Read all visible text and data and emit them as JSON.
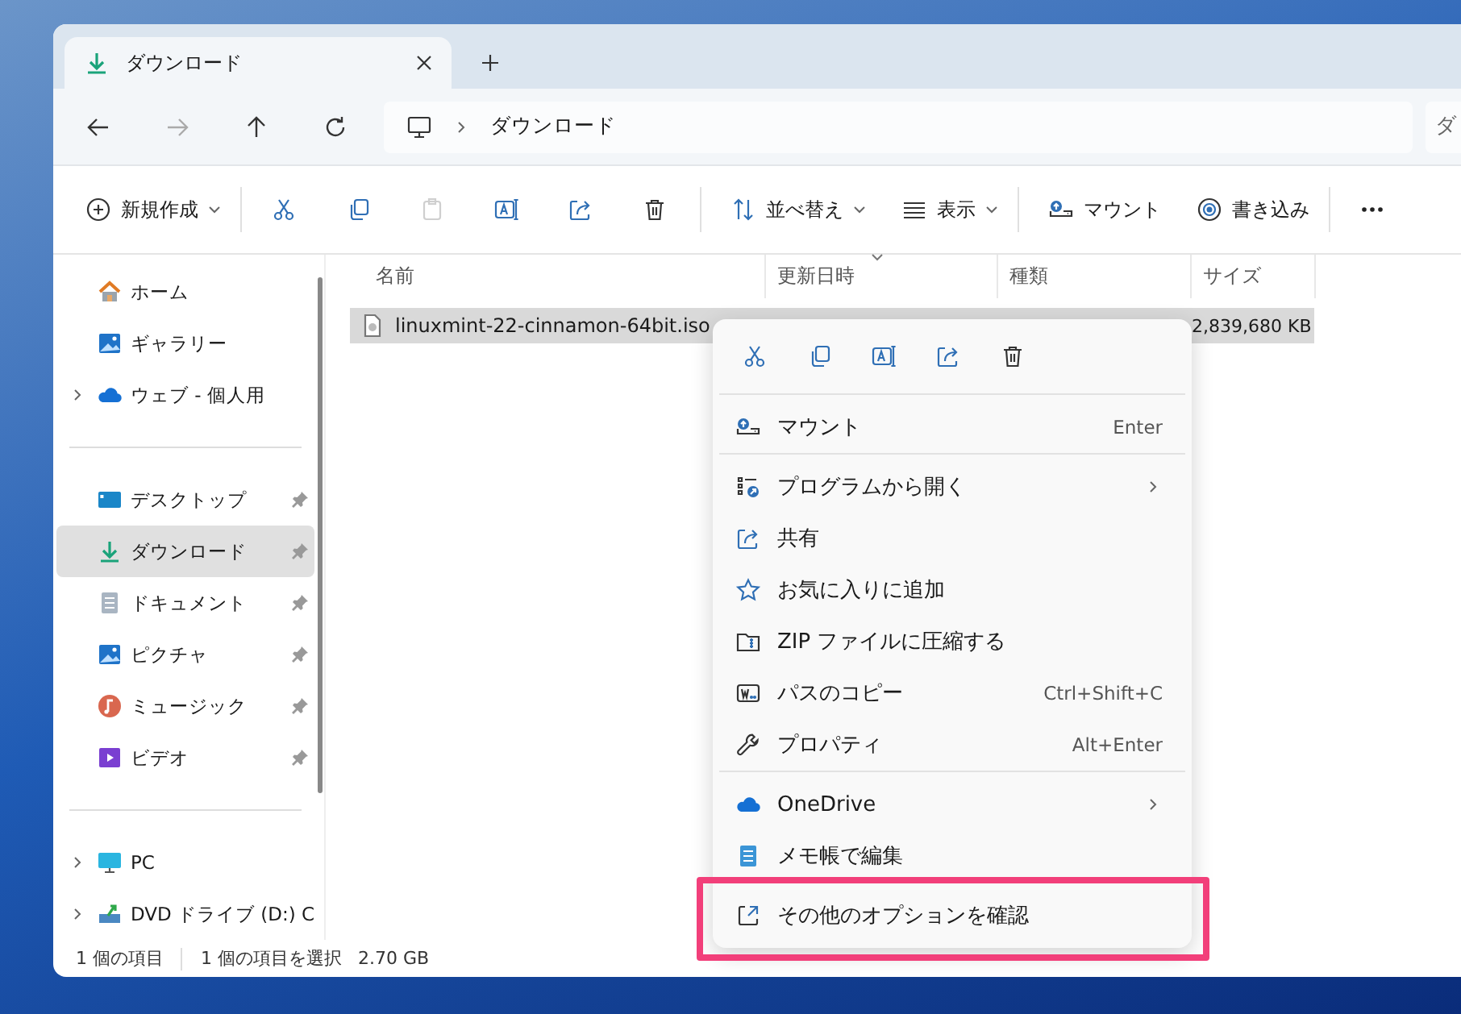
{
  "tabs": [
    {
      "label": "ダウンロード",
      "selected": true
    }
  ],
  "address": {
    "path": [
      "ダウンロード"
    ],
    "search_placeholder": "ダ"
  },
  "toolbar": [
    [
      {
        "kind": "new",
        "label": "新規作成",
        "dropdown": true,
        "disabled": false
      }
    ],
    [
      {
        "kind": "cut",
        "disabled": false
      },
      {
        "kind": "copy",
        "disabled": false
      },
      {
        "kind": "paste",
        "disabled": true
      },
      {
        "kind": "rename",
        "disabled": false
      },
      {
        "kind": "share",
        "disabled": false
      },
      {
        "kind": "delete",
        "disabled": false
      }
    ],
    [
      {
        "kind": "sort",
        "label": "並べ替え",
        "dropdown": true,
        "disabled": false
      },
      {
        "kind": "view",
        "label": "表示",
        "dropdown": true,
        "disabled": false
      }
    ],
    [
      {
        "kind": "mount",
        "label": "マウント",
        "dropdown": false,
        "disabled": false
      },
      {
        "kind": "burn",
        "label": "書き込み",
        "dropdown": false,
        "disabled": false
      }
    ],
    [
      {
        "kind": "more",
        "disabled": false
      }
    ]
  ],
  "sidebar": [
    [
      {
        "kind": "home",
        "label": "ホーム",
        "expandable": false,
        "pinned": false,
        "selected": false
      },
      {
        "kind": "gallery",
        "label": "ギャラリー",
        "expandable": false,
        "pinned": false,
        "selected": false
      },
      {
        "kind": "cloud",
        "label": "ウェブ - 個人用",
        "expandable": true,
        "pinned": false,
        "selected": false
      }
    ],
    [
      {
        "kind": "desktop",
        "label": "デスクトップ",
        "expandable": false,
        "pinned": true,
        "selected": false
      },
      {
        "kind": "download",
        "label": "ダウンロード",
        "expandable": false,
        "pinned": true,
        "selected": true
      },
      {
        "kind": "document",
        "label": "ドキュメント",
        "expandable": false,
        "pinned": true,
        "selected": false
      },
      {
        "kind": "pictures",
        "label": "ピクチャ",
        "expandable": false,
        "pinned": true,
        "selected": false
      },
      {
        "kind": "music",
        "label": "ミュージック",
        "expandable": false,
        "pinned": true,
        "selected": false
      },
      {
        "kind": "video",
        "label": "ビデオ",
        "expandable": false,
        "pinned": true,
        "selected": false
      }
    ],
    [
      {
        "kind": "pc",
        "label": "PC",
        "expandable": true,
        "pinned": false,
        "selected": false
      },
      {
        "kind": "dvd",
        "label": "DVD ドライブ (D:) C",
        "expandable": true,
        "pinned": false,
        "selected": false
      }
    ]
  ],
  "table": {
    "columns": [
      {
        "label": "名前",
        "sorted": false
      },
      {
        "label": "更新日時",
        "sorted": true
      },
      {
        "label": "種類",
        "sorted": false
      },
      {
        "label": "サイズ",
        "sorted": false
      }
    ],
    "rows": [
      {
        "name": "linuxmint-22-cinnamon-64bit.iso",
        "size": "2,839,680 KB",
        "selected": true
      }
    ]
  },
  "context_menu": {
    "quick_actions": [
      {
        "kind": "cut"
      },
      {
        "kind": "copy"
      },
      {
        "kind": "rename"
      },
      {
        "kind": "share"
      },
      {
        "kind": "delete"
      }
    ],
    "groups": [
      [
        {
          "kind": "mount",
          "label": "マウント",
          "shortcut": "Enter",
          "submenu": false,
          "highlighted": false
        }
      ],
      [
        {
          "kind": "open-with",
          "label": "プログラムから開く",
          "submenu": true,
          "highlighted": false
        },
        {
          "kind": "share",
          "label": "共有",
          "submenu": false,
          "highlighted": false
        },
        {
          "kind": "favorite",
          "label": "お気に入りに追加",
          "submenu": false,
          "highlighted": false
        },
        {
          "kind": "zip",
          "label": "ZIP ファイルに圧縮する",
          "submenu": false,
          "highlighted": false
        },
        {
          "kind": "path",
          "label": "パスのコピー",
          "shortcut": "Ctrl+Shift+C",
          "submenu": false,
          "highlighted": false
        },
        {
          "kind": "properties",
          "label": "プロパティ",
          "shortcut": "Alt+Enter",
          "submenu": false,
          "highlighted": false
        }
      ],
      [
        {
          "kind": "onedrive",
          "label": "OneDrive",
          "submenu": true,
          "highlighted": false
        },
        {
          "kind": "notepad",
          "label": "メモ帳で編集",
          "submenu": false,
          "highlighted": false
        }
      ],
      [
        {
          "kind": "more-options",
          "label": "その他のオプションを確認",
          "submenu": false,
          "highlighted": true
        }
      ]
    ]
  },
  "status_bar": [
    "1 個の項目",
    "1 個の項目を選択",
    "2.70 GB"
  ]
}
